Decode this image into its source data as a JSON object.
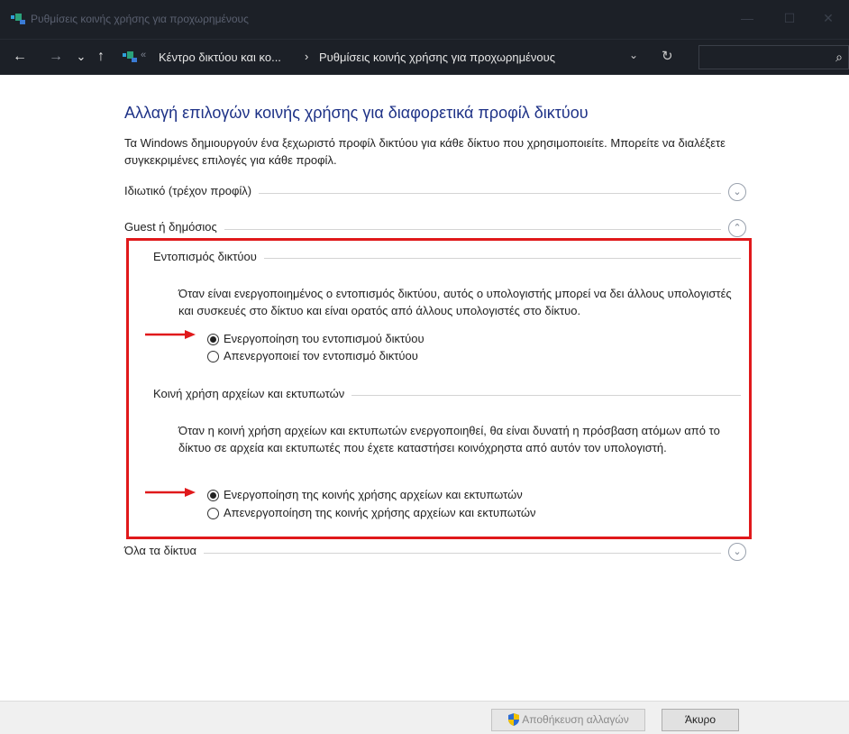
{
  "window": {
    "title": "Ρυθμίσεις κοινής χρήσης για προχωρημένους",
    "controls": {
      "minimize": "—",
      "maximize": "☐",
      "close": "✕"
    }
  },
  "nav": {
    "back": "←",
    "forward": "→",
    "recent": "⌄",
    "up": "↑",
    "separator": "«",
    "breadcrumb_1": "Κέντρο δικτύου και κο...",
    "breadcrumb_chevron": "›",
    "breadcrumb_2": "Ρυθμίσεις κοινής χρήσης για προχωρημένους",
    "dropdown": "⌄",
    "refresh": "↻",
    "search_icon": "⌕"
  },
  "main": {
    "heading": "Αλλαγή επιλογών κοινής χρήσης για διαφορετικά προφίλ δικτύου",
    "description": "Τα Windows δημιουργούν ένα ξεχωριστό προφίλ δικτύου για κάθε δίκτυο που χρησιμοποιείτε. Μπορείτε να διαλέξετε συγκεκριμένες επιλογές για κάθε προφίλ.",
    "profiles": {
      "private": {
        "label": "Ιδιωτικό (τρέχον προφίλ)",
        "toggle": "⌄"
      },
      "guest": {
        "label": "Guest ή δημόσιος",
        "toggle": "⌃"
      },
      "all": {
        "label": "Όλα τα δίκτυα",
        "toggle": "⌄"
      }
    },
    "network_discovery": {
      "title": "Εντοπισμός δικτύου",
      "description": "Όταν είναι ενεργοποιημένος ο εντοπισμός δικτύου, αυτός ο υπολογιστής μπορεί να δει άλλους υπολογιστές και συσκευές στο δίκτυο και είναι ορατός από άλλους υπολογιστές στο δίκτυο.",
      "on_label": "Ενεργοποίηση του εντοπισμού δικτύου",
      "off_label": "Απενεργοποιεί τον εντοπισμό δικτύου",
      "selected": "on"
    },
    "file_sharing": {
      "title": "Κοινή χρήση αρχείων και εκτυπωτών",
      "description": "Όταν η κοινή χρήση αρχείων και εκτυπωτών ενεργοποιηθεί, θα είναι δυνατή η πρόσβαση ατόμων από το δίκτυο σε αρχεία και εκτυπωτές που έχετε καταστήσει κοινόχρηστα από αυτόν τον υπολογιστή.",
      "on_label": "Ενεργοποίηση της κοινής χρήσης αρχείων και εκτυπωτών",
      "off_label": "Απενεργοποίηση της κοινής χρήσης αρχείων και εκτυπωτών",
      "selected": "on"
    }
  },
  "footer": {
    "save_label": "Αποθήκευση αλλαγών",
    "cancel_label": "Άκυρο"
  },
  "colors": {
    "heading": "#1e3287",
    "highlight_box": "#e0191b",
    "arrow": "#e0191b",
    "titlebar": "#1c2027"
  }
}
